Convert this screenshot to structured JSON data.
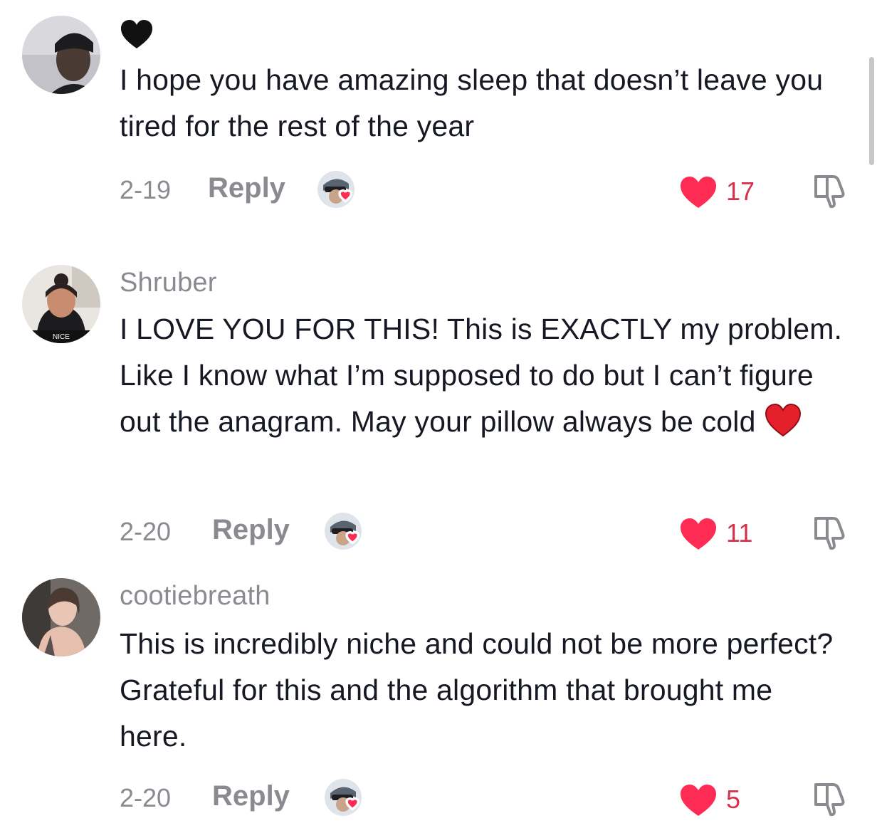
{
  "comments": [
    {
      "username": "",
      "emoji": "black-heart",
      "text": "I hope you have amazing sleep that doesn’t leave you tired for the rest of the year",
      "date": "2-19",
      "reply_label": "Reply",
      "likes": "17"
    },
    {
      "username": "Shruber",
      "text": "I LOVE YOU FOR THIS! This is EXACTLY my problem. Like I know what I’m supposed to do but I can’t figure out the anagram. May your pillow always be cold",
      "trailing_emoji": "red-heart",
      "avatar_label": "NICE",
      "date": "2-20",
      "reply_label": "Reply",
      "likes": "11"
    },
    {
      "username": "cootiebreath",
      "text": "This is incredibly niche and could not be more perfect? Grateful for this and the algorithm that brought me here.",
      "date": "2-20",
      "reply_label": "Reply",
      "likes": "5"
    }
  ],
  "colors": {
    "like_red": "#fe2c55",
    "muted_text": "#8a8b91",
    "primary_text": "#161823"
  },
  "icons": [
    "black-heart-icon",
    "red-heart-icon",
    "like-heart-icon",
    "dislike-icon",
    "creator-liked-icon"
  ]
}
